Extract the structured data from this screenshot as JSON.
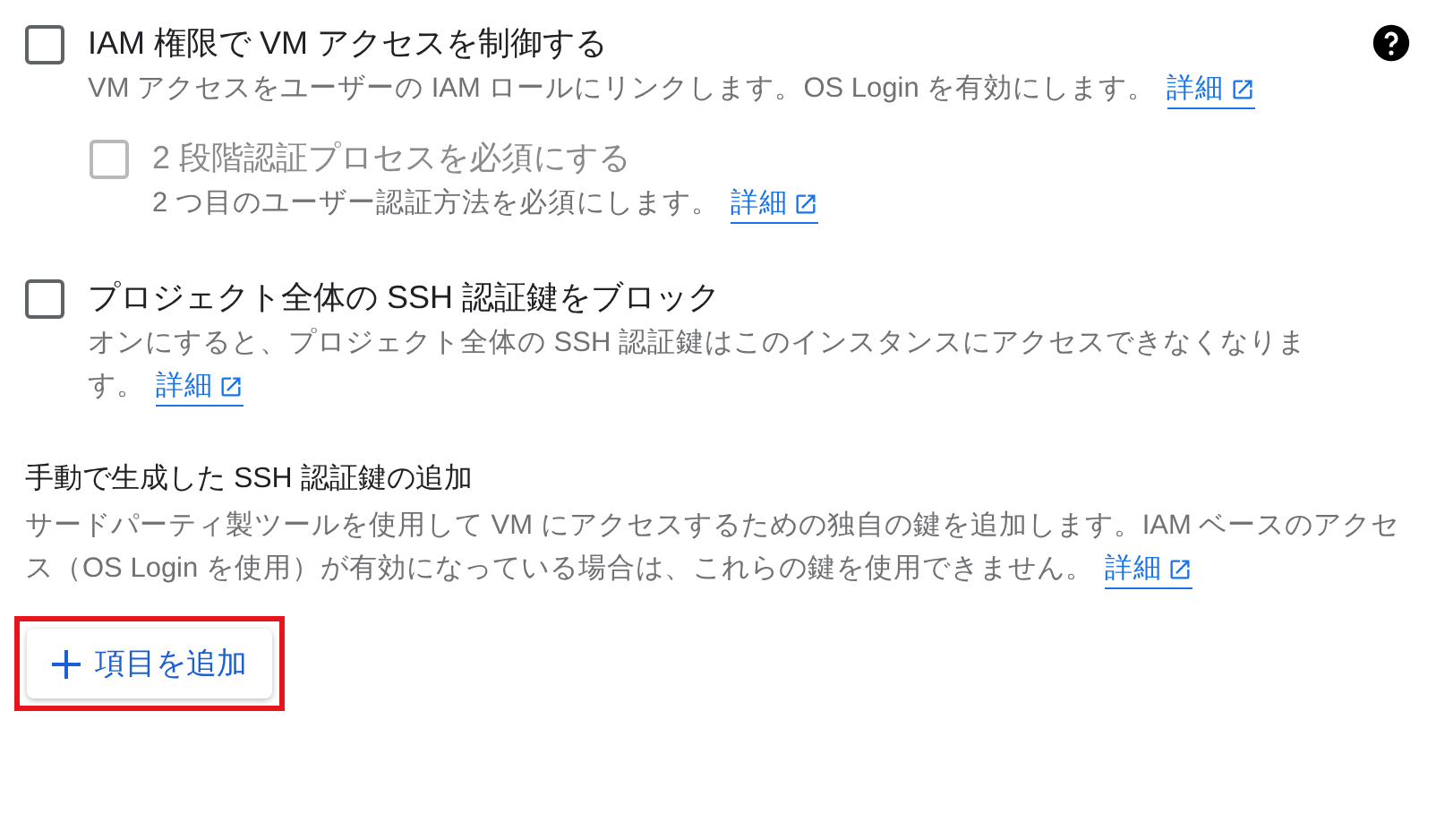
{
  "options": [
    {
      "kind": "checkbox",
      "label": "IAM 権限で VM アクセスを制御する",
      "checked": false,
      "disabled": false,
      "help": true,
      "description": "VM アクセスをユーザーの IAM ロールにリンクします。OS Login を有効にします。",
      "link": "詳細",
      "children": [
        {
          "kind": "checkbox",
          "label": "2 段階認証プロセスを必須にする",
          "checked": false,
          "disabled": true,
          "description": "2 つ目のユーザー認証方法を必須にします。",
          "link": "詳細"
        }
      ]
    },
    {
      "kind": "checkbox",
      "label": "プロジェクト全体の SSH 認証鍵をブロック",
      "checked": false,
      "disabled": false,
      "description": "オンにすると、プロジェクト全体の SSH 認証鍵はこのインスタンスにアクセスできなくなります。",
      "link": "詳細"
    }
  ],
  "manual_keys": {
    "title": "手動で生成した SSH 認証鍵の追加",
    "description": "サードパーティ製ツールを使用して VM にアクセスするための独自の鍵を追加します。IAM ベースのアクセス（OS Login を使用）が有効になっている場合は、これらの鍵を使用できません。",
    "link": "詳細",
    "add_button": {
      "label": "項目を追加",
      "highlighted": true
    }
  }
}
